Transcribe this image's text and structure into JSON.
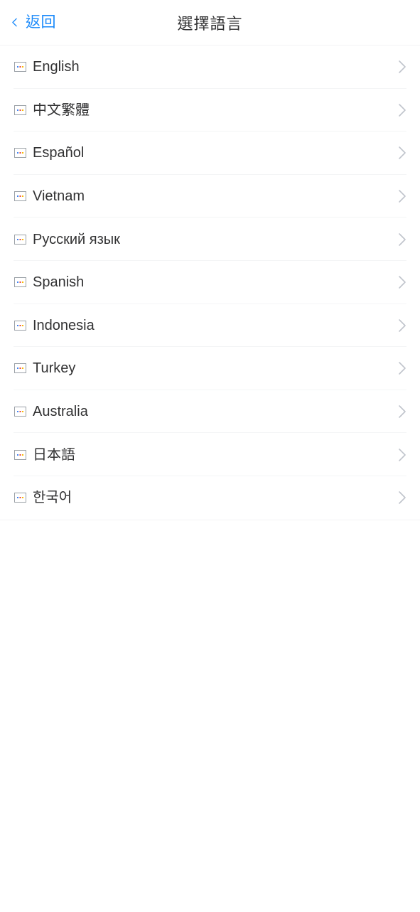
{
  "header": {
    "back_label": "返回",
    "back_icon": "chevron-left-icon",
    "title": "選擇語言",
    "accent_color": "#1989fa",
    "title_color": "#323233"
  },
  "list": {
    "row_icon": "broken-image-placeholder-icon",
    "row_chevron_icon": "chevron-right-icon",
    "divider_color": "#f4f5f6",
    "items": [
      {
        "label": "English"
      },
      {
        "label": "中文繁體"
      },
      {
        "label": "Español"
      },
      {
        "label": "Vietnam"
      },
      {
        "label": "Русский язык"
      },
      {
        "label": "Spanish"
      },
      {
        "label": "Indonesia"
      },
      {
        "label": "Turkey"
      },
      {
        "label": "Australia"
      },
      {
        "label": "日本語"
      },
      {
        "label": "한국어"
      }
    ]
  }
}
